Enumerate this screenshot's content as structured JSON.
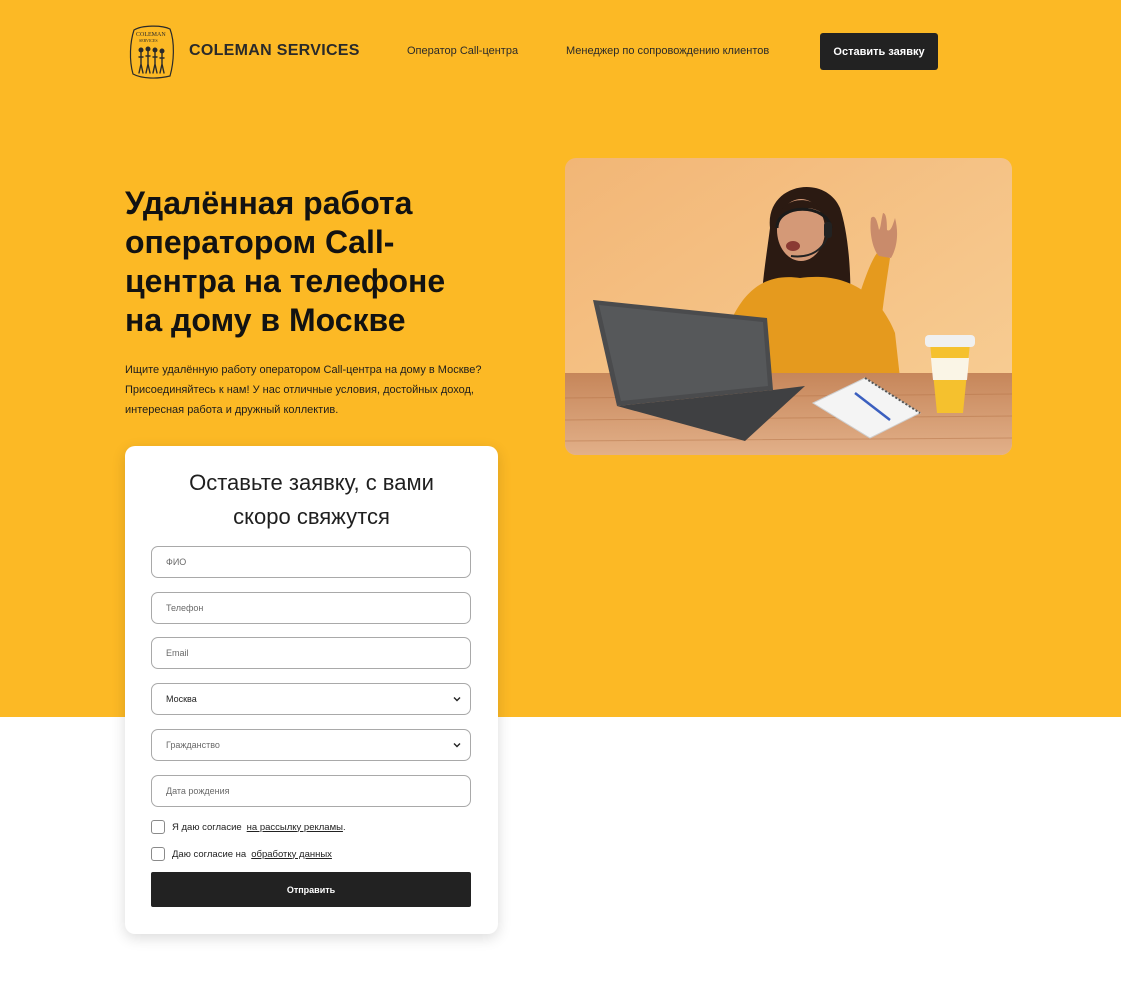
{
  "header": {
    "logo_text": "COLEMAN SERVICES",
    "brand": "COLEMAN SERVICES",
    "nav": [
      {
        "label": "Оператор Call-центра"
      },
      {
        "label": "Менеджер по сопровождению клиентов"
      }
    ],
    "cta_label": "Оставить заявку"
  },
  "hero": {
    "title": "Удалённая работа оператором Call-центра на телефоне на дому в Москве",
    "description": "Ищите удалённую работу оператором Call-центра на дому в Москве? Присоединяйтесь к нам! У нас отличные условия, достойных доход, интересная работа и дружный коллектив."
  },
  "form": {
    "title": "Оставьте заявку, с вами скоро свяжутся",
    "fields": {
      "name_placeholder": "ФИО",
      "phone_placeholder": "Телефон",
      "email_placeholder": "Email",
      "city_value": "Москва",
      "citizenship_placeholder": "Гражданство",
      "birthdate_placeholder": "Дата рождения"
    },
    "consent_ads_text": "Я даю согласие",
    "consent_ads_link": "на рассылку рекламы",
    "consent_ads_suffix": ".",
    "consent_data_text": "Даю согласие на",
    "consent_data_link": "обработку данных",
    "submit_label": "Отправить"
  },
  "colors": {
    "accent": "#fcb925",
    "button": "#222222"
  },
  "icons": {
    "logo": "coleman-logo-icon",
    "select_chevron": "chevron-down-icon"
  }
}
